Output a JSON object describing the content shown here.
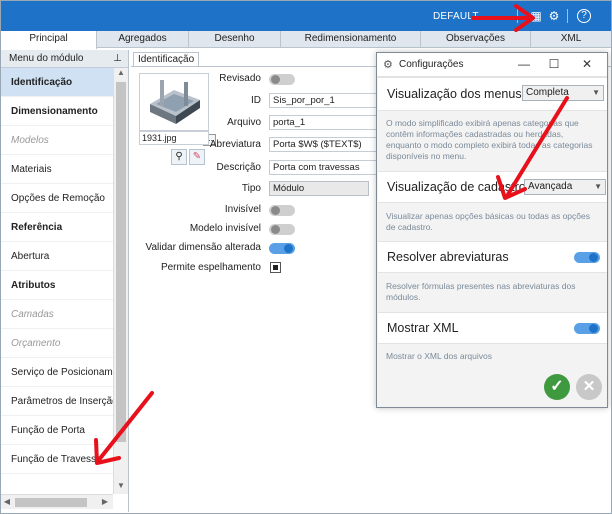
{
  "topbar": {
    "profile": "DEFAULT",
    "icons": [
      "grid-icon",
      "gears-icon",
      "help-icon"
    ]
  },
  "tabs": [
    {
      "label": "Principal",
      "active": true
    },
    {
      "label": "Agregados"
    },
    {
      "label": "Desenho"
    },
    {
      "label": "Redimensionamento"
    },
    {
      "label": "Observações"
    },
    {
      "label": "XML"
    }
  ],
  "left_panel": {
    "header": "Menu do módulo",
    "pin": "ᵖ",
    "items": [
      {
        "label": "Identificação",
        "style": "selected"
      },
      {
        "label": "Dimensionamento",
        "style": "bold"
      },
      {
        "label": "Modelos",
        "style": "italic"
      },
      {
        "label": "Materiais",
        "style": "normal"
      },
      {
        "label": "Opções de Remoção",
        "style": "normal"
      },
      {
        "label": "Referência",
        "style": "bold"
      },
      {
        "label": "Abertura",
        "style": "normal"
      },
      {
        "label": "Atributos",
        "style": "bold"
      },
      {
        "label": "Camadas",
        "style": "italic"
      },
      {
        "label": "Orçamento",
        "style": "italic"
      },
      {
        "label": "Serviço de Posicionamento",
        "style": "normal"
      },
      {
        "label": "Parâmetros de Inserção",
        "style": "normal"
      },
      {
        "label": "Função de Porta",
        "style": "normal"
      },
      {
        "label": "Função de Travessa",
        "style": "normal"
      }
    ]
  },
  "form": {
    "subtab": "Identificação",
    "image_file": "1931.jpg",
    "dots_button": "...",
    "labels": {
      "revisado": "Revisado",
      "id": "ID",
      "arquivo": "Arquivo",
      "abreviatura": "Abreviatura",
      "descricao": "Descrição",
      "tipo": "Tipo",
      "invisivel": "Invisível",
      "modelo_invisivel": "Modelo invisível",
      "validar": "Validar dimensão alterada",
      "espelhamento": "Permite espelhamento"
    },
    "values": {
      "id": "Sis_por_por_1",
      "arquivo": "porta_1",
      "abreviatura": "Porta $W$ ($TEXT$)",
      "descricao": "Porta com travessas",
      "tipo": "Módulo"
    },
    "toggles": {
      "revisado": false,
      "invisivel": false,
      "modelo_invisivel": false,
      "validar": true
    },
    "permite_espelhamento": true
  },
  "dialog": {
    "title": "Configurações",
    "controls": {
      "minimize": "—",
      "maximize": "☐",
      "close": "✕"
    },
    "menus_label": "Visualização dos menus",
    "menus_value": "Completa",
    "menus_desc": "O modo simplificado exibirá apenas categorias que contêm informações cadastradas ou herdadas, enquanto o modo completo exibirá todas as categorias disponíveis no menu.",
    "cadastro_label": "Visualização de cadastro",
    "cadastro_value": "Avançada",
    "cadastro_desc": "Visualizar apenas opções básicas ou todas as opções de cadastro.",
    "abrev_label": "Resolver abreviaturas",
    "abrev_on": true,
    "abrev_desc": "Resolver fórmulas presentes nas abreviaturas dos módulos.",
    "xml_label": "Mostrar XML",
    "xml_on": true,
    "xml_desc": "Mostrar o XML dos arquivos",
    "ok": "✓",
    "cancel": "✕"
  },
  "colors": {
    "topbar": "#1e73c8",
    "selected_item": "#cfe1f3",
    "ok_button": "#3f9a3f",
    "annotation_arrow": "#e8101a"
  }
}
